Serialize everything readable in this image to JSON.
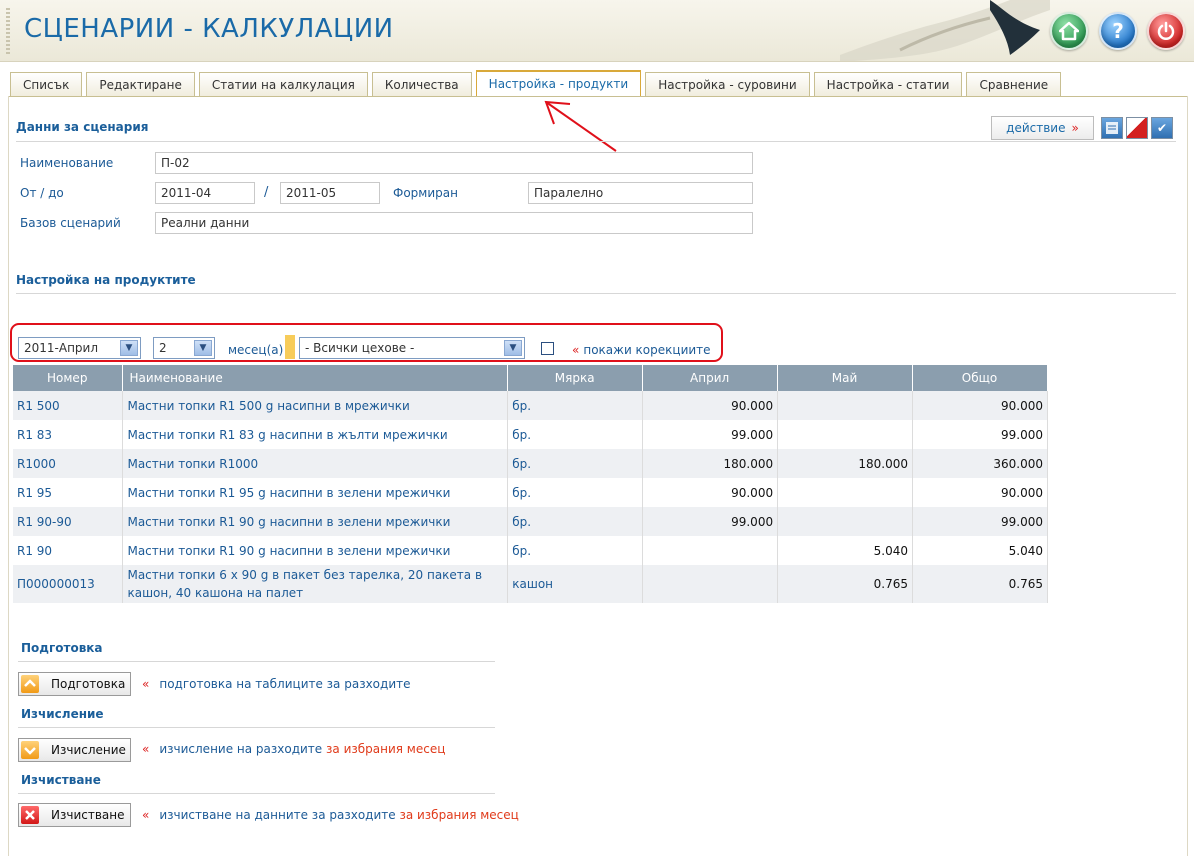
{
  "header": {
    "title": "СЦЕНАРИИ - КАЛКУЛАЦИИ",
    "buttons": [
      "home-icon",
      "help-icon",
      "power-icon"
    ]
  },
  "tabs": [
    {
      "label": "Списък"
    },
    {
      "label": "Редактиране"
    },
    {
      "label": "Статии на калкулация"
    },
    {
      "label": "Количества"
    },
    {
      "label": "Настройка - продукти",
      "active": true
    },
    {
      "label": "Настройка - суровини"
    },
    {
      "label": "Настройка - статии"
    },
    {
      "label": "Сравнение"
    }
  ],
  "scenario": {
    "section_title": "Данни за сценария",
    "action_label": "действие",
    "action_marker": "»",
    "name_label": "Наименование",
    "name_value": "П-02",
    "period_label": "От / до",
    "from_value": "2011-04",
    "separator": "/",
    "to_value": "2011-05",
    "formed_label": "Формиран",
    "formed_value": "Паралелно",
    "base_label": "Базов сценарий",
    "base_value": "Реални данни"
  },
  "products": {
    "section_title": "Настройка на продуктите",
    "filter": {
      "month": "2011-Април",
      "count": "2",
      "count_unit": "месец(а)",
      "workshop": "- Всички цехове -",
      "show_corrections": "покажи корекциите",
      "marker": "«"
    },
    "columns": [
      "Номер",
      "Наименование",
      "Мярка",
      "Април",
      "Май",
      "Общо"
    ],
    "rows": [
      {
        "no": "R1 500",
        "name": "Мастни топки R1 500 g насипни в мрежички",
        "unit": "бр.",
        "apr": "90.000",
        "may": "",
        "total": "90.000"
      },
      {
        "no": "R1 83",
        "name": "Мастни топки R1 83 g насипни в жълти мрежички",
        "unit": "бр.",
        "apr": "99.000",
        "may": "",
        "total": "99.000"
      },
      {
        "no": "R1000",
        "name": "Мастни топки R1000",
        "unit": "бр.",
        "apr": "180.000",
        "may": "180.000",
        "total": "360.000"
      },
      {
        "no": "R1 95",
        "name": "Мастни топки R1 95 g насипни в зелени мрежички",
        "unit": "бр.",
        "apr": "90.000",
        "may": "",
        "total": "90.000"
      },
      {
        "no": "R1 90-90",
        "name": "Мастни топки R1 90 g насипни в зелени мрежички",
        "unit": "бр.",
        "apr": "99.000",
        "may": "",
        "total": "99.000"
      },
      {
        "no": "R1 90",
        "name": "Мастни топки R1 90 g насипни в зелени мрежички",
        "unit": "бр.",
        "apr": "",
        "may": "5.040",
        "total": "5.040"
      },
      {
        "no": "П000000013",
        "name": "Мастни топки 6 x 90 g в пакет без тарелка, 20 пакета в кашон, 40 кашона на палет",
        "unit": "кашон",
        "apr": "",
        "may": "0.765",
        "total": "0.765"
      }
    ]
  },
  "prepare": {
    "section_title": "Подготовка",
    "button": "Подготовка",
    "marker": "«",
    "desc": "подготовка на таблиците за разходите"
  },
  "compute": {
    "section_title": "Изчисление",
    "button": "Изчисление",
    "marker": "«",
    "desc": "изчисление на разходите",
    "desc_hl": "за избрания месец"
  },
  "clear": {
    "section_title": "Изчистване",
    "button": "Изчистване",
    "marker": "«",
    "desc": "изчистване на данните за разходите",
    "desc_hl": "за избрания месец"
  },
  "colors": {
    "accent": "#1a6aa8",
    "table_header": "#8b9eae",
    "highlight_red": "#e0101a",
    "tab_active_border": "#d9a93a"
  }
}
